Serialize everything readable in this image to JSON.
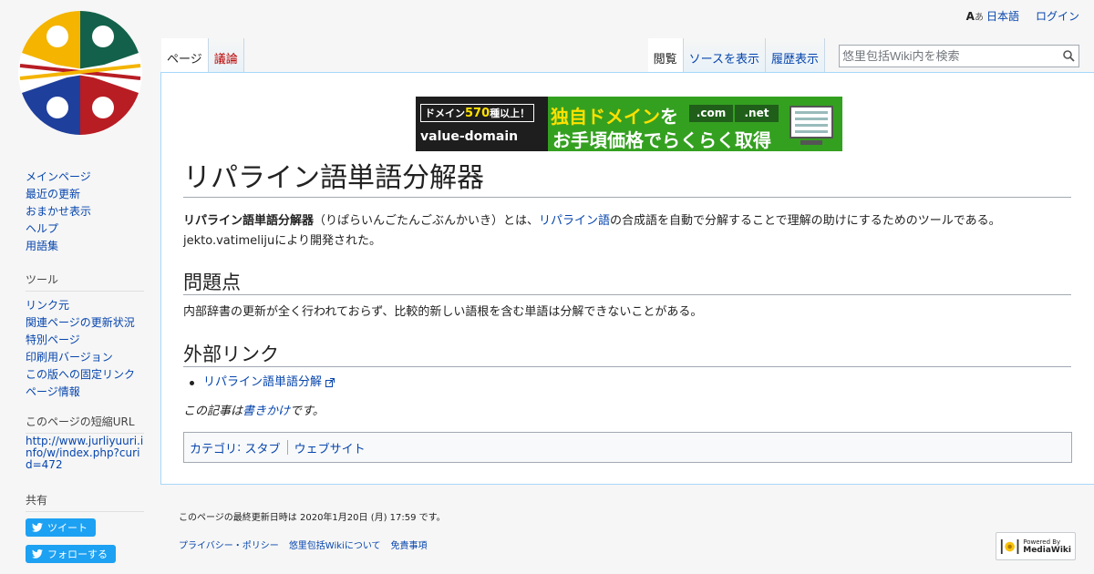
{
  "personal": {
    "language": "日本語",
    "login": "ログイン"
  },
  "tabs": {
    "page": "ページ",
    "talk": "議論",
    "read": "閲覧",
    "view_source": "ソースを表示",
    "history": "履歴表示"
  },
  "search": {
    "placeholder": "悠里包括Wiki内を検索"
  },
  "banner": {
    "badge_pre": "ドメイン",
    "badge_num": "570",
    "badge_post": "種以上！",
    "brand": "value-domain",
    "headline_a": "独自ドメイン",
    "headline_b": "を",
    "com": ".com",
    "net": ".net",
    "subline": "お手頃価格でらくらく取得"
  },
  "article": {
    "title": "リパライン語単語分解器",
    "intro_bold": "リパライン語単語分解器",
    "intro_reading": "（りぱらいんごたんごぶんかいき）とは、",
    "intro_link": "リパライン語",
    "intro_rest": "の合成語を自動で分解することで理解の助けにするためのツールである。",
    "intro_line2": "jekto.vatimelijuにより開発された。",
    "h2_problems": "問題点",
    "problems_text": "内部辞書の更新が全く行われておらず、比較的新しい語根を含む単語は分解できないことがある。",
    "h2_external": "外部リンク",
    "external_links": [
      "リパライン語単語分解"
    ],
    "stub_pre": "この記事は",
    "stub_link": "書きかけ",
    "stub_post": "です。"
  },
  "categories": {
    "label": "カテゴリ",
    "items": [
      "スタブ",
      "ウェブサイト"
    ]
  },
  "sidebar": {
    "nav": [
      "メインページ",
      "最近の更新",
      "おまかせ表示",
      "ヘルプ",
      "用語集"
    ],
    "tools_heading": "ツール",
    "tools": [
      "リンク元",
      "関連ページの更新状況",
      "特別ページ",
      "印刷用バージョン",
      "この版への固定リンク",
      "ページ情報"
    ],
    "shorturl_heading": "このページの短縮URL",
    "shorturl": "http://www.jurliyuuri.info/w/index.php?curid=472",
    "share_heading": "共有",
    "tweet": "ツイート",
    "follow": "フォローする"
  },
  "footer": {
    "lastmod": "このページの最終更新日時は 2020年1月20日 (月) 17:59 です。",
    "links": [
      "プライバシー・ポリシー",
      "悠里包括Wikiについて",
      "免責事項"
    ],
    "powered_small": "Powered By",
    "powered_big": "MediaWiki"
  },
  "colors": {
    "link": "#0645ad",
    "new_link": "#ba0000",
    "twitter": "#1da1f2"
  }
}
